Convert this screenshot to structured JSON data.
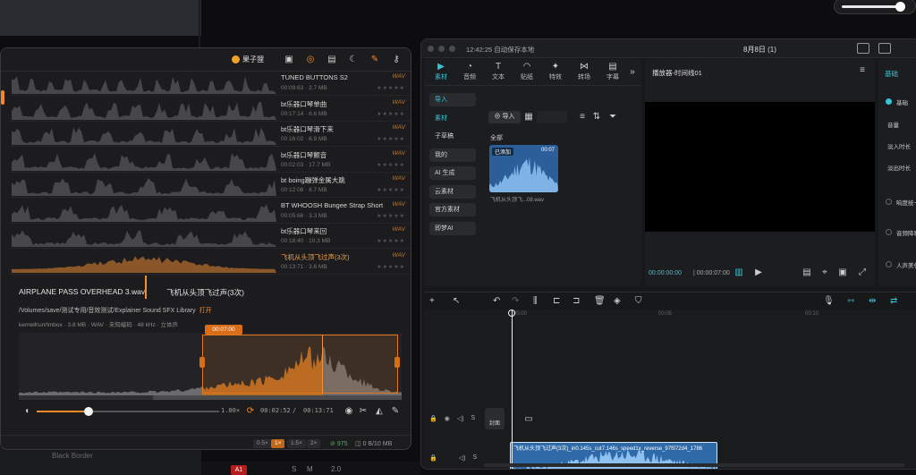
{
  "desktop": {
    "bottom_left_label": "Black Border",
    "a1_badge": "A1",
    "s_label": "S",
    "m_label": "M",
    "value_20": "2.0"
  },
  "volume": {
    "level": 0.92
  },
  "sound_library": {
    "brand": "果子狸",
    "icons": [
      "archive-icon",
      "bulb-icon",
      "message-icon",
      "moon-icon",
      "pin-icon",
      "key-icon",
      "settings-icon"
    ],
    "items": [
      {
        "name": "TUNED BUTTONS S2",
        "duration": "00:09:63",
        "size": "2.7 MB",
        "format": "WAV"
      },
      {
        "name": "bt乐器口琴单曲",
        "duration": "00:17:14",
        "size": "6.6 MB",
        "format": "WAV"
      },
      {
        "name": "bt乐器口琴滑下来",
        "duration": "00:16:02",
        "size": "6.9 MB",
        "format": "WAV"
      },
      {
        "name": "bt乐器口琴颤音",
        "duration": "00:02:03",
        "size": "17.7 MB",
        "format": "WAV"
      },
      {
        "name": "bt boing蹦弹金属大跳",
        "duration": "00:12:08",
        "size": "6.7 MB",
        "format": "WAV"
      },
      {
        "name": "BT WHOOSH Bungee Strap Short",
        "duration": "00:05:66",
        "size": "3.3 MB",
        "format": "WAV"
      },
      {
        "name": "bt乐器口琴来回",
        "duration": "00:18:40",
        "size": "10.3 MB",
        "format": "WAV"
      },
      {
        "name": "飞机从头顶飞过声(3次)",
        "duration": "00:13:71",
        "size": "3.6 MB",
        "format": "WAV"
      }
    ],
    "current_file": "AIRPLANE PASS OVERHEAD 3.wav",
    "current_title": "飞机从头顶飞过声(3次)",
    "path": "/Volumes/save/测试专用/音效测试/Explainer Sound SFX Library",
    "open_label": "打开",
    "detail": "kernelKun/Imbox · 3.8 MB · WAV · 未知编码 · 48 kHz · 立体声",
    "selection_time": "00:07:00",
    "speed": "1.00×",
    "time_current": "00:02:52",
    "time_total": "00:13:71",
    "speeds": [
      "0.5×",
      "1×",
      "1.5×",
      "2×"
    ],
    "speed_active_index": 1,
    "count": "975",
    "storage": "0 B/10 MB"
  },
  "jianying": {
    "autosave": "12:42:25 自动保存本地",
    "project": "8月8日 (1)",
    "tabs": [
      {
        "label": "素材",
        "icon": "media-icon"
      },
      {
        "label": "音频",
        "icon": "audio-icon"
      },
      {
        "label": "文本",
        "icon": "text-icon"
      },
      {
        "label": "贴纸",
        "icon": "sticker-icon"
      },
      {
        "label": "特效",
        "icon": "effects-icon"
      },
      {
        "label": "转场",
        "icon": "transition-icon"
      },
      {
        "label": "字幕",
        "icon": "subtitle-icon"
      }
    ],
    "sidebar": [
      "导入",
      "素材",
      "子草稿",
      "我的",
      "AI 生成",
      "云素材",
      "官方素材",
      "即梦AI"
    ],
    "import_button": "导入",
    "all_header": "全部",
    "thumb_tag": "已添加",
    "thumb_duration": "00:07",
    "thumb_name": "飞机从头顶飞...08.wav",
    "player_title": "播放器-时间线01",
    "timecode_current": "00:00:00:00",
    "timecode_total": "00:00:07:00",
    "inspector_tabs": [
      "基础"
    ],
    "inspector_rows": [
      "基础",
      "音量",
      "淡入时长",
      "淡出时长",
      "响度统一",
      "音频降噪",
      "人声美化"
    ],
    "ruler_labels": [
      "00:00",
      "00:05",
      "00:10"
    ],
    "cover_label": "封面",
    "clip_label": "飞机从头顶飞过声(3次)_in0.145s_cut7.146s_speed1x_reverse_97f072d4_1786"
  }
}
